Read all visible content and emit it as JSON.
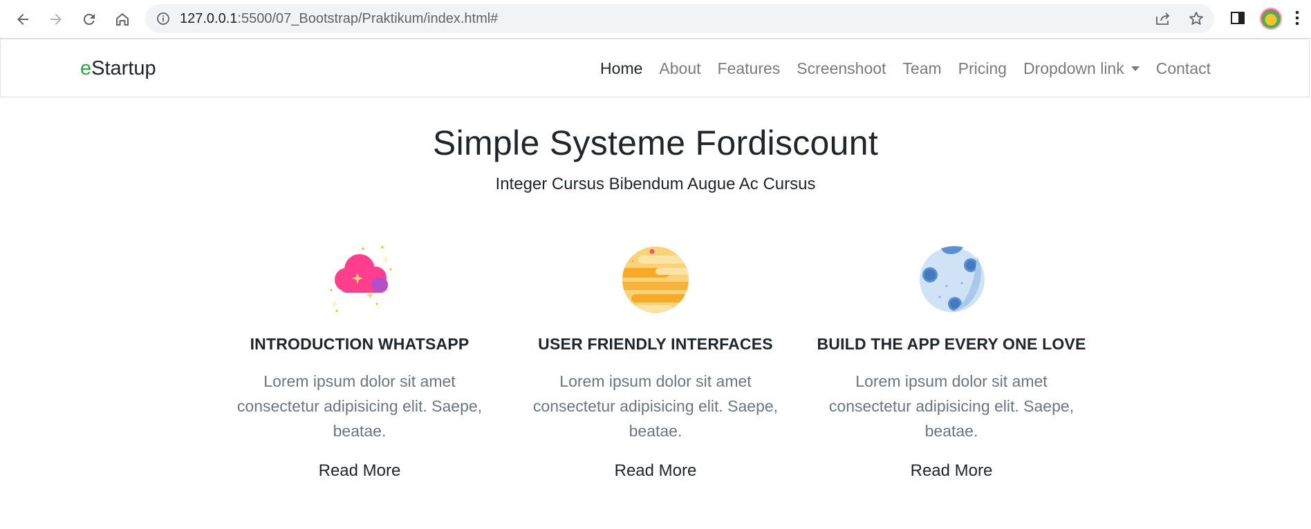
{
  "browser": {
    "url_host": "127.0.0.1",
    "url_rest": ":5500/07_Bootstrap/Praktikum/index.html#"
  },
  "navbar": {
    "brand_prefix": "e",
    "brand_rest": "Startup",
    "links": [
      "Home",
      "About",
      "Features",
      "Screenshoot",
      "Team",
      "Pricing",
      "Dropdown link",
      "Contact"
    ],
    "active": "Home"
  },
  "hero": {
    "title": "Simple Systeme Fordiscount",
    "subtitle": "Integer Cursus Bibendum Augue Ac Cursus"
  },
  "features": [
    {
      "icon": "pink-cloud-icon",
      "title": "INTRODUCTION WHATSAPP",
      "text": "Lorem ipsum dolor sit amet consectetur adipisicing elit. Saepe, beatae.",
      "link": "Read More"
    },
    {
      "icon": "yellow-planet-icon",
      "title": "USER FRIENDLY INTERFACES",
      "text": "Lorem ipsum dolor sit amet consectetur adipisicing elit. Saepe, beatae.",
      "link": "Read More"
    },
    {
      "icon": "blue-moon-icon",
      "title": "BUILD THE APP EVERY ONE LOVE",
      "text": "Lorem ipsum dolor sit amet consectetur adipisicing elit. Saepe, beatae.",
      "link": "Read More"
    }
  ],
  "colors": {
    "brand_accent": "#28a745",
    "nav_link": "#7a7a7a",
    "text_muted": "#6c757d"
  }
}
